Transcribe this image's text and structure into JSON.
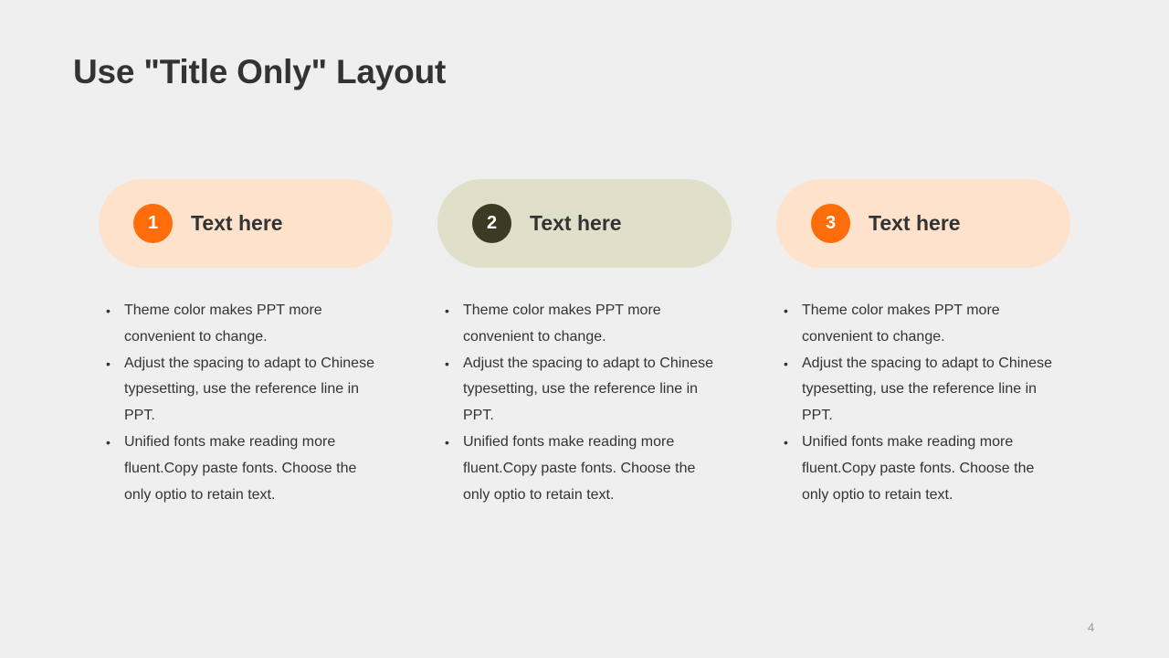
{
  "slide": {
    "title": "Use \"Title Only\" Layout",
    "page_number": "4"
  },
  "colors": {
    "background": "#f0efef",
    "orange_accent": "#ff6d0a",
    "dark_olive": "#3a3b22",
    "peach_pill": "#fee2cc",
    "olive_pill": "#e0e0ca",
    "text": "#333333"
  },
  "columns": [
    {
      "number": "1",
      "heading": "Text here",
      "bullet_marker": "•",
      "bullets": [
        "Theme  color makes PPT more convenient to change.",
        "Adjust the spacing to adapt to Chinese typesetting, use the reference line in PPT.",
        "Unified fonts make reading more fluent.Copy paste fonts. Choose the only optio to retain text."
      ]
    },
    {
      "number": "2",
      "heading": "Text here",
      "bullet_marker": "•",
      "bullets": [
        "Theme  color makes PPT more convenient to change.",
        "Adjust the spacing to adapt to Chinese typesetting, use the reference line in PPT.",
        "Unified fonts make reading more fluent.Copy paste fonts. Choose the only optio to retain text."
      ]
    },
    {
      "number": "3",
      "heading": "Text here",
      "bullet_marker": "•",
      "bullets": [
        "Theme  color makes PPT more convenient to change.",
        "Adjust the spacing to adapt to Chinese typesetting, use the reference line in PPT.",
        "Unified fonts make reading more fluent.Copy paste fonts. Choose the only optio to retain text."
      ]
    }
  ]
}
